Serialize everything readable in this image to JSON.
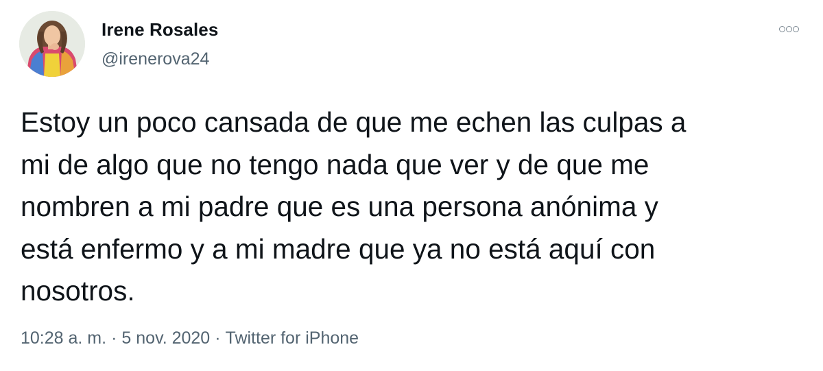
{
  "author": {
    "name": "Irene Rosales",
    "handle": "@irenerova24",
    "avatar_icon": "profile-photo"
  },
  "actions": {
    "more_icon": "more-options-icon"
  },
  "tweet": {
    "lines": [
      "Estoy un poco cansada de que me echen las culpas a",
      "mi de algo que no tengo nada que ver y de que me",
      "nombren a mi padre que es una persona anónima y",
      "está enfermo y a mi madre que ya no está aquí con",
      "nosotros."
    ]
  },
  "meta": {
    "time": "10:28 a. m.",
    "separator": "·",
    "date": "5 nov. 2020",
    "source": "Twitter for iPhone"
  },
  "colors": {
    "text": "#0f1419",
    "secondary": "#536471",
    "background": "#ffffff"
  }
}
